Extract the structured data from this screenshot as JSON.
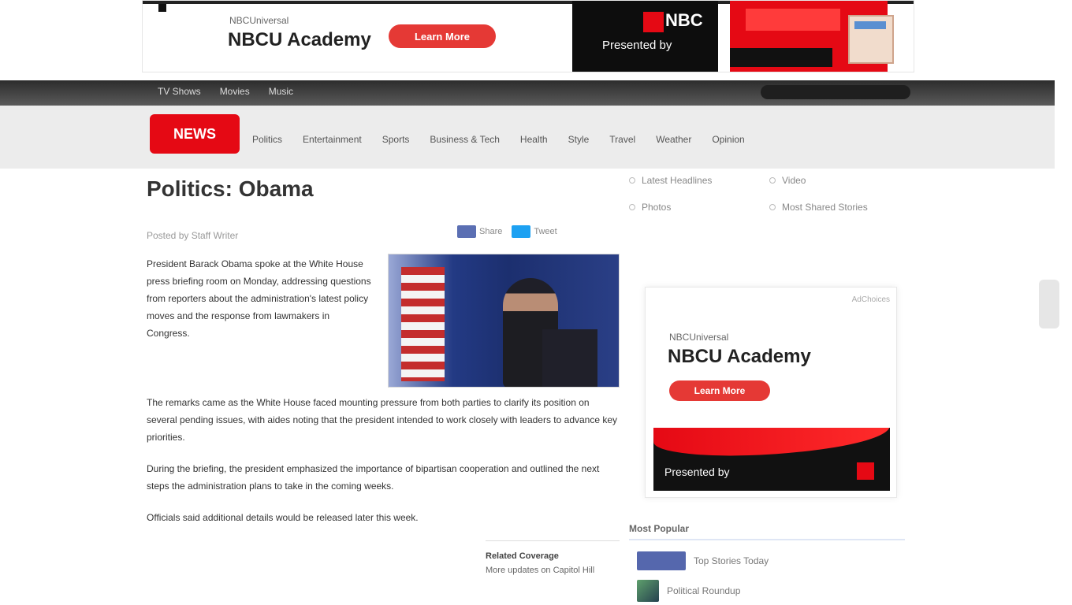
{
  "top_ad": {
    "brand_small": "NBCUniversal",
    "brand_big": "NBCU Academy",
    "cta": "Learn More",
    "tag": "Presented by"
  },
  "top_nav": {
    "links": [
      "TV Shows",
      "Movies",
      "Music"
    ]
  },
  "main_nav": {
    "logo": "NEWS",
    "items": [
      "Politics",
      "Entertainment",
      "Sports",
      "Business & Tech",
      "Health",
      "Style",
      "Travel",
      "Weather",
      "Opinion"
    ]
  },
  "article": {
    "title": "Politics: Obama",
    "meta": "Posted by Staff Writer",
    "share": {
      "facebook": "Share",
      "twitter": "Tweet"
    },
    "intro": "President Barack Obama spoke at the White House press briefing room on Monday, addressing questions from reporters about the administration's latest policy moves and the response from lawmakers in Congress.",
    "body": [
      "The remarks came as the White House faced mounting pressure from both parties to clarify its position on several pending issues, with aides noting that the president intended to work closely with leaders to advance key priorities.",
      "During the briefing, the president emphasized the importance of bipartisan cooperation and outlined the next steps the administration plans to take in the coming weeks.",
      "Officials said additional details would be released later this week."
    ],
    "inline_box_title": "Related Coverage",
    "inline_box_text": "More updates on Capitol Hill"
  },
  "sidebar": {
    "links": [
      "Latest Headlines",
      "Video",
      "Photos",
      "Most Shared Stories"
    ],
    "ad": {
      "tag": "AdChoices",
      "brand_small": "NBCUniversal",
      "brand_big": "NBCU Academy",
      "cta": "Learn More",
      "tag_line": "Presented by"
    },
    "popular_header": "Most Popular",
    "popular_items": [
      "Top Stories Today",
      "Political Roundup"
    ]
  }
}
